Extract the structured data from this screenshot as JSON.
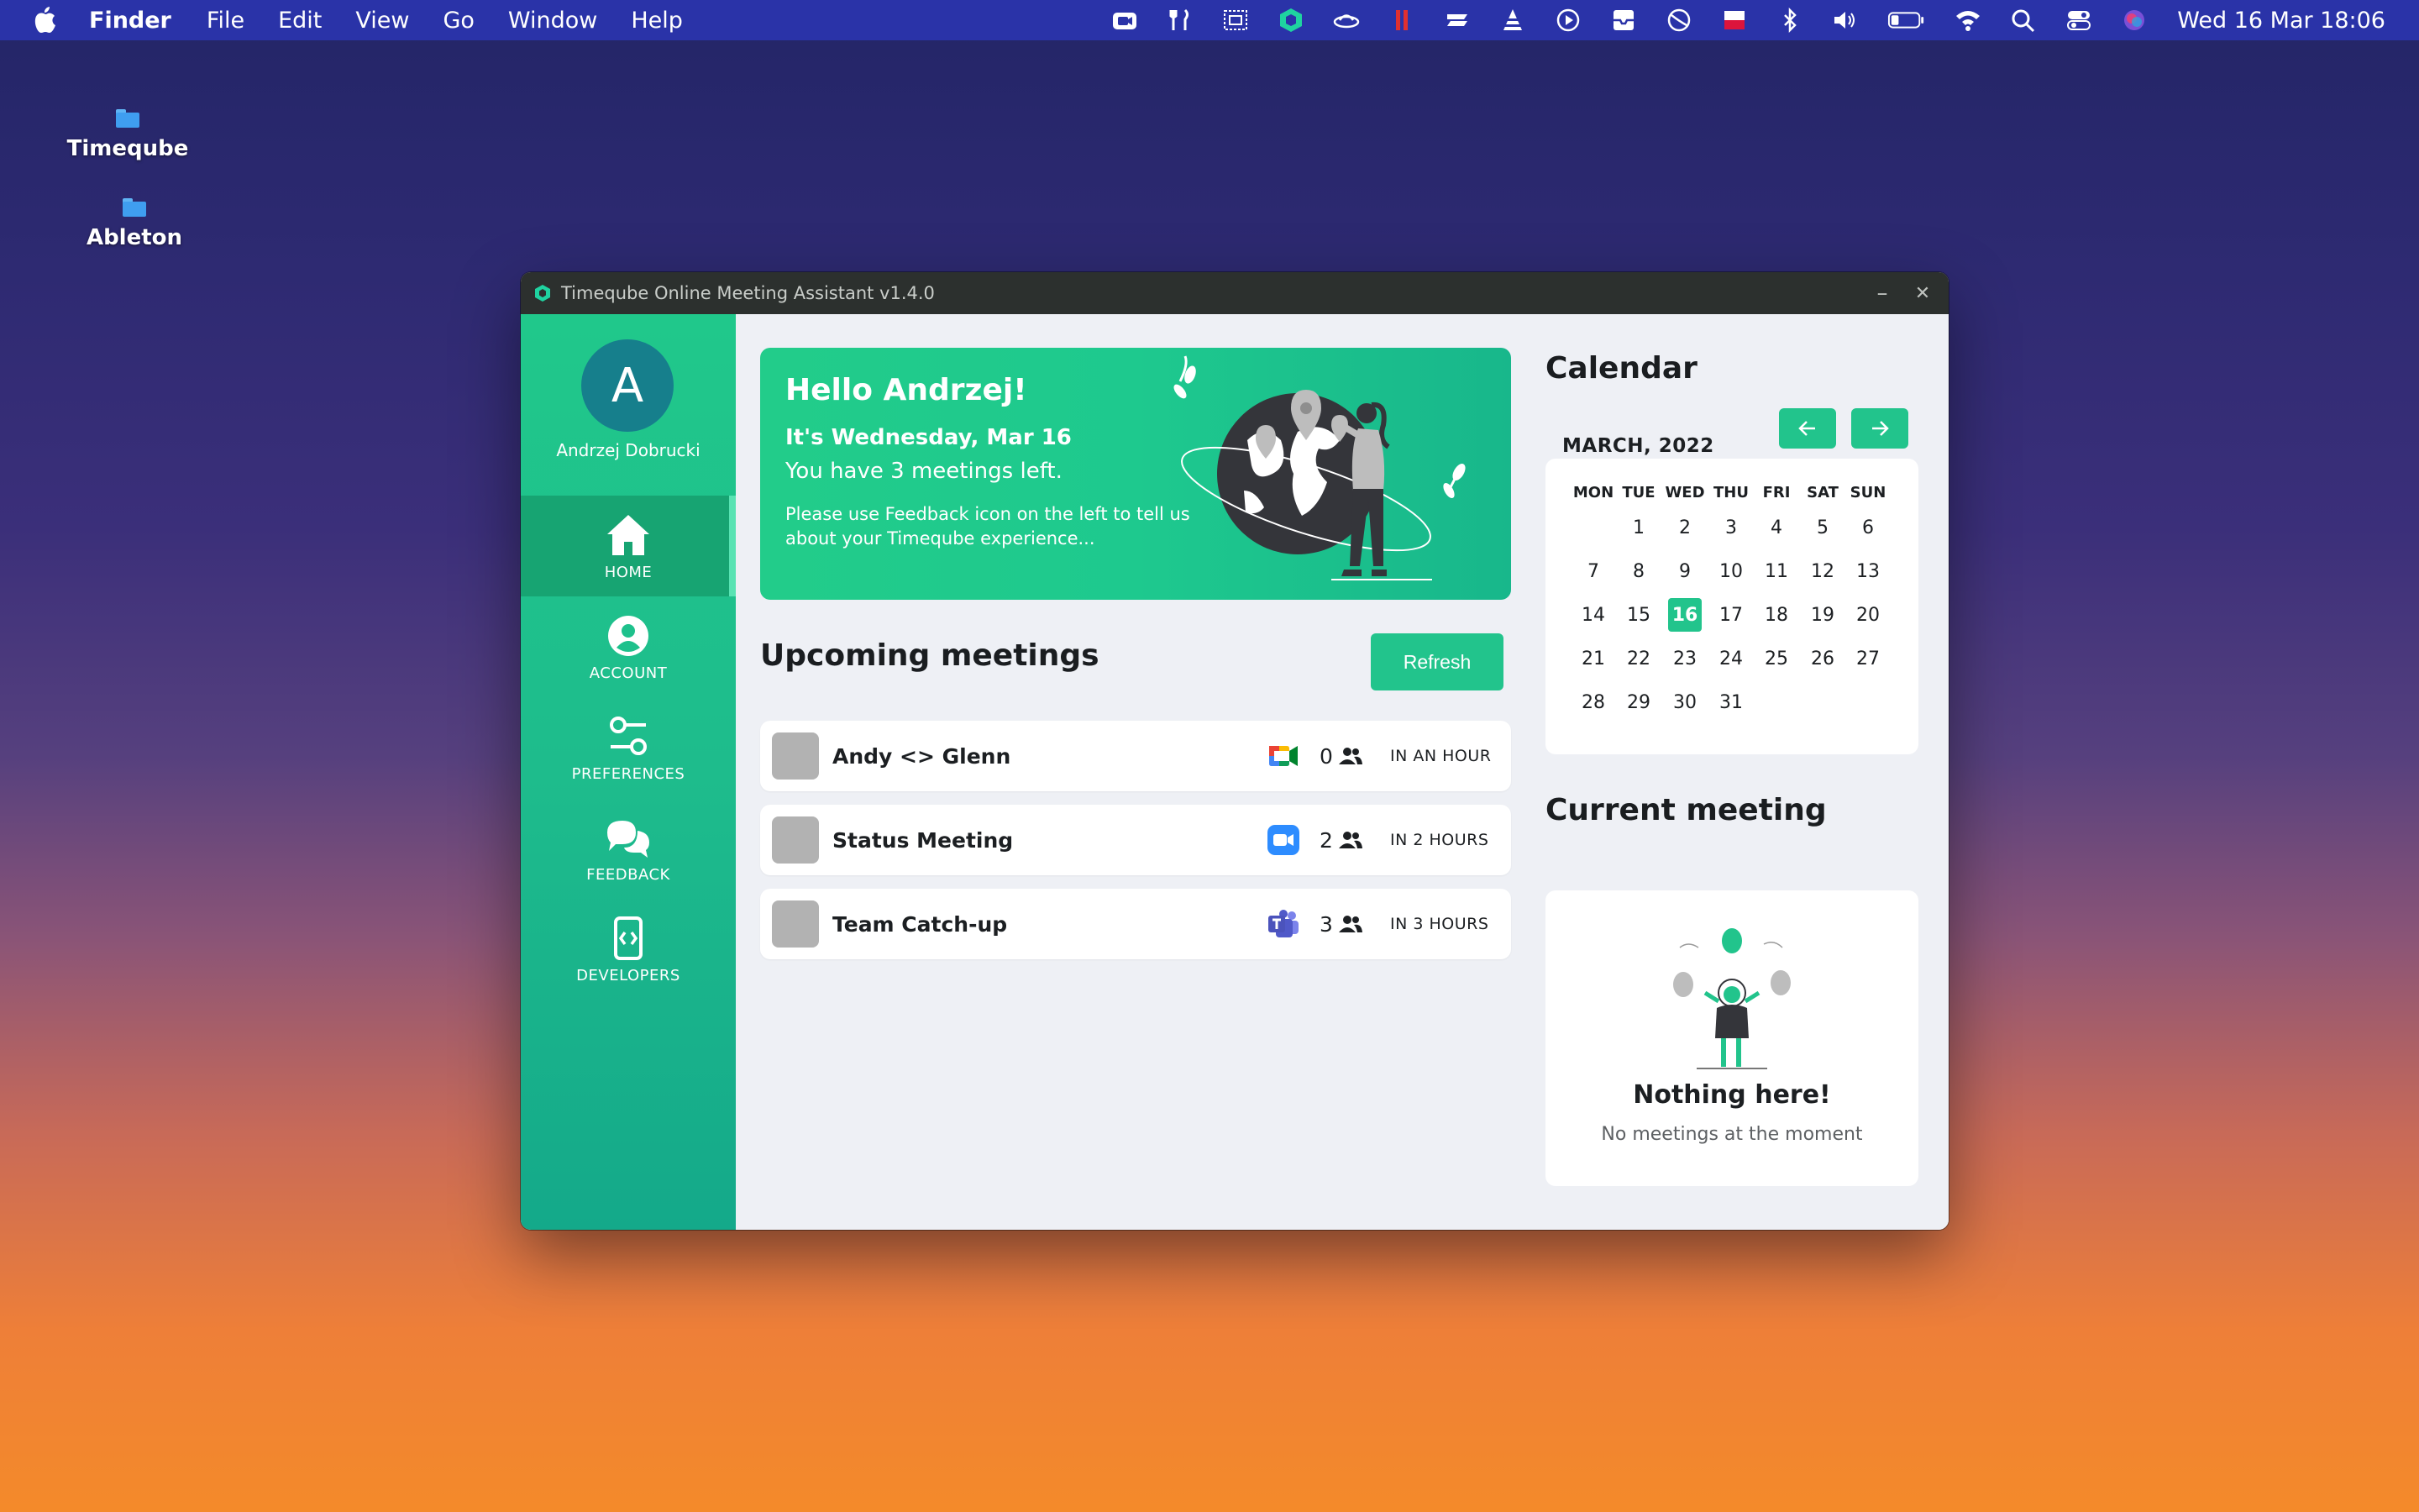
{
  "menubar": {
    "app_name": "Finder",
    "menus": [
      "File",
      "Edit",
      "View",
      "Go",
      "Window",
      "Help"
    ],
    "status_icons": [
      "zoom-icon",
      "tools-icon",
      "screen-capture-icon",
      "timeqube-icon",
      "ufo-icon",
      "pause-icon",
      "stack-icon",
      "vlc-icon",
      "play-circle-icon",
      "inbox-icon",
      "restrict-icon",
      "flag-icon",
      "bluetooth-icon",
      "volume-icon",
      "battery-icon",
      "wifi-icon",
      "search-icon",
      "control-center-icon",
      "siri-icon"
    ],
    "clock": "Wed 16 Mar  18:06"
  },
  "desktop": {
    "icons": [
      {
        "label": "Timeqube"
      },
      {
        "label": "Ableton"
      }
    ]
  },
  "window": {
    "title": "Timeqube Online Meeting Assistant v1.4.0",
    "minimize": "–",
    "close": "✕"
  },
  "sidebar": {
    "avatar_letter": "A",
    "username": "Andrzej Dobrucki",
    "items": [
      {
        "label": "HOME",
        "icon": "home-icon",
        "active": true
      },
      {
        "label": "ACCOUNT",
        "icon": "account-icon"
      },
      {
        "label": "PREFERENCES",
        "icon": "preferences-icon"
      },
      {
        "label": "FEEDBACK",
        "icon": "feedback-icon"
      },
      {
        "label": "DEVELOPERS",
        "icon": "developers-icon"
      }
    ]
  },
  "hero": {
    "greeting": "Hello Andrzej!",
    "date": "It's Wednesday, Mar 16",
    "meetings_left": "You have 3 meetings left.",
    "note": "Please use Feedback icon on the left to tell us about your Timeqube experience..."
  },
  "upcoming": {
    "title": "Upcoming meetings",
    "refresh_label": "Refresh",
    "meetings": [
      {
        "name": "Andy <> Glenn",
        "platform": "google-meet-icon",
        "participants": "0",
        "when": "IN AN HOUR"
      },
      {
        "name": "Status Meeting",
        "platform": "zoom-icon",
        "participants": "2",
        "when": "IN 2 HOURS"
      },
      {
        "name": "Team Catch-up",
        "platform": "teams-icon",
        "participants": "3",
        "when": "IN 3 HOURS"
      }
    ]
  },
  "calendar": {
    "title": "Calendar",
    "month": "MARCH, 2022",
    "weekdays": [
      "MON",
      "TUE",
      "WED",
      "THU",
      "FRI",
      "SAT",
      "SUN"
    ],
    "days": [
      "1",
      "2",
      "3",
      "4",
      "5",
      "6",
      "7",
      "8",
      "9",
      "10",
      "11",
      "12",
      "13",
      "14",
      "15",
      "16",
      "17",
      "18",
      "19",
      "20",
      "21",
      "22",
      "23",
      "24",
      "25",
      "26",
      "27",
      "28",
      "29",
      "30",
      "31"
    ],
    "first_weekday_index": 1,
    "today": "16",
    "accent": "#22c48c"
  },
  "current_meeting": {
    "title": "Current meeting",
    "empty_title": "Nothing here!",
    "empty_subtitle": "No meetings at the moment"
  }
}
